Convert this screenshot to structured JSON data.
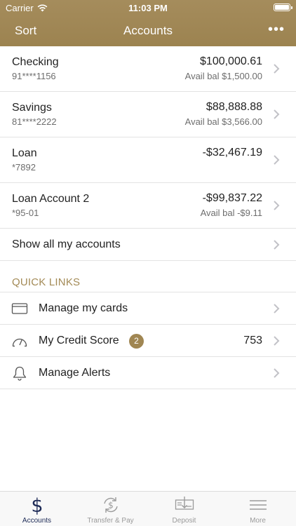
{
  "status_bar": {
    "carrier": "Carrier",
    "time": "11:03 PM"
  },
  "nav": {
    "left": "Sort",
    "title": "Accounts",
    "more": "•••"
  },
  "accounts": [
    {
      "name": "Checking",
      "number": "91****1156",
      "balance": "$100,000.61",
      "available": "Avail bal $1,500.00"
    },
    {
      "name": "Savings",
      "number": "81****2222",
      "balance": "$88,888.88",
      "available": "Avail bal $3,566.00"
    },
    {
      "name": "Loan",
      "number": "*7892",
      "balance": "-$32,467.19",
      "available": ""
    },
    {
      "name": "Loan Account 2",
      "number": "*95-01",
      "balance": "-$99,837.22",
      "available": "Avail bal -$9.11"
    }
  ],
  "show_all": "Show all my accounts",
  "quick_links": {
    "header": "QUICK LINKS",
    "items": [
      {
        "label": "Manage my cards",
        "icon": "credit-card-icon"
      },
      {
        "label": "My Credit Score",
        "badge": "2",
        "value": "753",
        "icon": "speedometer-icon"
      },
      {
        "label": "Manage Alerts",
        "icon": "bell-icon"
      }
    ]
  },
  "tabs": [
    {
      "label": "Accounts",
      "icon": "dollar-icon",
      "active": true
    },
    {
      "label": "Transfer & Pay",
      "icon": "transfer-icon"
    },
    {
      "label": "Deposit",
      "icon": "check-deposit-icon"
    },
    {
      "label": "More",
      "icon": "menu-icon"
    }
  ],
  "colors": {
    "brand": "#a08652",
    "active_tab": "#1d2a56",
    "muted": "#9a9a9a"
  }
}
